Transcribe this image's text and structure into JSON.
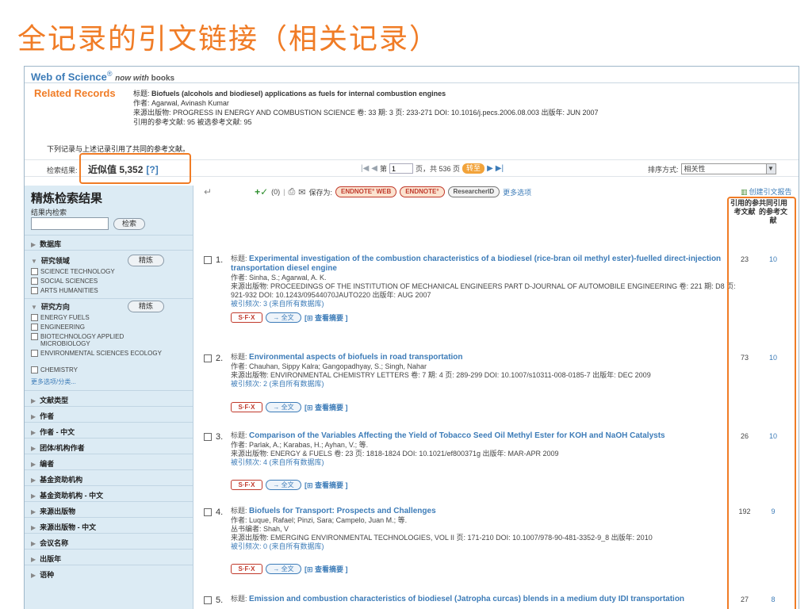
{
  "slide": {
    "title": "全记录的引文链接（相关记录）"
  },
  "brand": {
    "name": "Web of Science",
    "sup": "®",
    "tail_pre": "now with",
    "tail_bold": "books"
  },
  "source": {
    "heading": "Related Records",
    "title_label": "标题:",
    "title": "Biofuels (alcohols and biodiesel) applications as fuels for internal combustion engines",
    "authors": "作者: Agarwal, Avinash Kumar",
    "journal": "来源出版物: PROGRESS IN ENERGY AND COMBUSTION SCIENCE  卷: 33  期: 3  页: 233-271  DOI: 10.1016/j.pecs.2006.08.003  出版年: JUN 2007",
    "refs": "引用的参考文献: 95  被选参考文献: 95"
  },
  "shared_note": "下列记录与上述记录引用了共同的参考文献。",
  "results_bar": {
    "label": "检索结果:",
    "approx": "近似值 5,352",
    "help": "[?]",
    "page_prefix": "第",
    "page_value": "1",
    "page_suffix": "页，共 536 页",
    "go": "转至",
    "sort_label": "排序方式:",
    "sort_value": "相关性"
  },
  "toolbar": {
    "marked": "(0)",
    "save_as": "保存为:",
    "endnote_web": "ENDNOTE° WEB",
    "endnote": "ENDNOTE°",
    "researcherid": "ResearcherID",
    "more": "更多选项"
  },
  "report": {
    "label": "创建引文报告"
  },
  "columns": {
    "cited": "引用的参考文献",
    "shared": "共同引用的参考文献"
  },
  "sidebar": {
    "title": "精炼检索结果",
    "search_within": "结果内检索",
    "search_btn": "检索",
    "refine_btn": "精炼",
    "sec_db": "数据库",
    "sec_area": "研究领域",
    "areas": [
      "SCIENCE TECHNOLOGY",
      "SOCIAL SCIENCES",
      "ARTS HUMANITIES"
    ],
    "sec_dir": "研究方向",
    "dirs": [
      "ENERGY FUELS",
      "ENGINEERING",
      "BIOTECHNOLOGY APPLIED MICROBIOLOGY",
      "ENVIRONMENTAL SCIENCES ECOLOGY",
      "CHEMISTRY"
    ],
    "more": "更多选项/分类...",
    "others": [
      "文献类型",
      "作者",
      "作者 - 中文",
      "团体/机构作者",
      "编者",
      "基金资助机构",
      "基金资助机构 - 中文",
      "来源出版物",
      "来源出版物 - 中文",
      "会议名称",
      "出版年",
      "语种"
    ]
  },
  "actions": {
    "sfx": "S·F·X",
    "fulltext": "→ 全文",
    "abstract": "[⊞ 查看摘要 ]"
  },
  "records": [
    {
      "num": "1.",
      "title": "Experimental investigation of the combustion characteristics of a biodiesel (rice-bran oil methyl ester)-fuelled direct-injection transportation diesel engine",
      "authors": "作者: Sinha, S.; Agarwal, A. K.",
      "source": "来源出版物: PROCEEDINGS OF THE INSTITUTION OF MECHANICAL ENGINEERS PART D-JOURNAL OF AUTOMOBILE ENGINEERING  卷: 221  期: D8  页: 921-932  DOI: 10.1243/09544070JAUTO220  出版年: AUG 2007",
      "times_cited": "被引频次: 3 (来自所有数据库)",
      "cited": "23",
      "shared": "10"
    },
    {
      "num": "2.",
      "title": "Environmental aspects of biofuels in road transportation",
      "authors": "作者: Chauhan, Sippy Kalra; Gangopadhyay, S.; Singh, Nahar",
      "source": "来源出版物: ENVIRONMENTAL CHEMISTRY LETTERS  卷: 7  期: 4  页: 289-299  DOI: 10.1007/s10311-008-0185-7  出版年: DEC 2009",
      "times_cited": "被引频次: 2 (来自所有数据库)",
      "cited": "73",
      "shared": "10"
    },
    {
      "num": "3.",
      "title": "Comparison of the Variables Affecting the Yield of Tobacco Seed Oil Methyl Ester for KOH and NaOH Catalysts",
      "authors": "作者: Parlak, A.; Karabas, H.; Ayhan, V.; 等.",
      "source": "来源出版物: ENERGY & FUELS  卷: 23  页: 1818-1824  DOI: 10.1021/ef800371g  出版年: MAR-APR 2009",
      "times_cited": "被引频次: 4 (来自所有数据库)",
      "cited": "26",
      "shared": "10"
    },
    {
      "num": "4.",
      "title": "Biofuels for Transport: Prospects and Challenges",
      "authors": "作者: Luque, Rafael; Pinzi, Sara; Campelo, Juan M.; 等.",
      "editors": "丛书编者: Shah, V",
      "source": "来源出版物: EMERGING ENVIRONMENTAL TECHNOLOGIES, VOL II  页: 171-210  DOI: 10.1007/978-90-481-3352-9_8  出版年: 2010",
      "times_cited": "被引频次: 0 (来自所有数据库)",
      "cited": "192",
      "shared": "9"
    },
    {
      "num": "5.",
      "title": "Emission and combustion characteristics of biodiesel (Jatropha curcas) blends in a medium duty IDI transportation",
      "cited": "27",
      "shared": "8"
    }
  ]
}
